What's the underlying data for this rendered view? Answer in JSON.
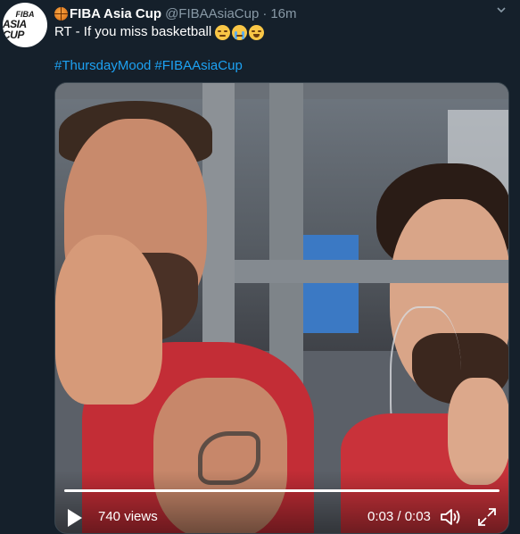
{
  "tweet": {
    "avatar": {
      "line1": "FIBA",
      "line2": "ASIA CUP"
    },
    "display_name": "FIBA Asia Cup",
    "handle": "@FIBAAsiaCup",
    "separator": "·",
    "time": "16m",
    "text": "RT - If you miss basketball",
    "emojis": [
      "unamused-face-icon",
      "loudly-crying-face-icon",
      "rolling-on-floor-laughing-icon"
    ],
    "hashtags": [
      "#ThursdayMood",
      "#FIBAAsiaCup"
    ]
  },
  "video": {
    "views": "740 views",
    "timestamp": "0:03 / 0:03",
    "progress": 1.0
  },
  "colors": {
    "background": "#15202b",
    "link": "#1da1f2",
    "muted": "#8899a6",
    "text": "#ffffff"
  }
}
